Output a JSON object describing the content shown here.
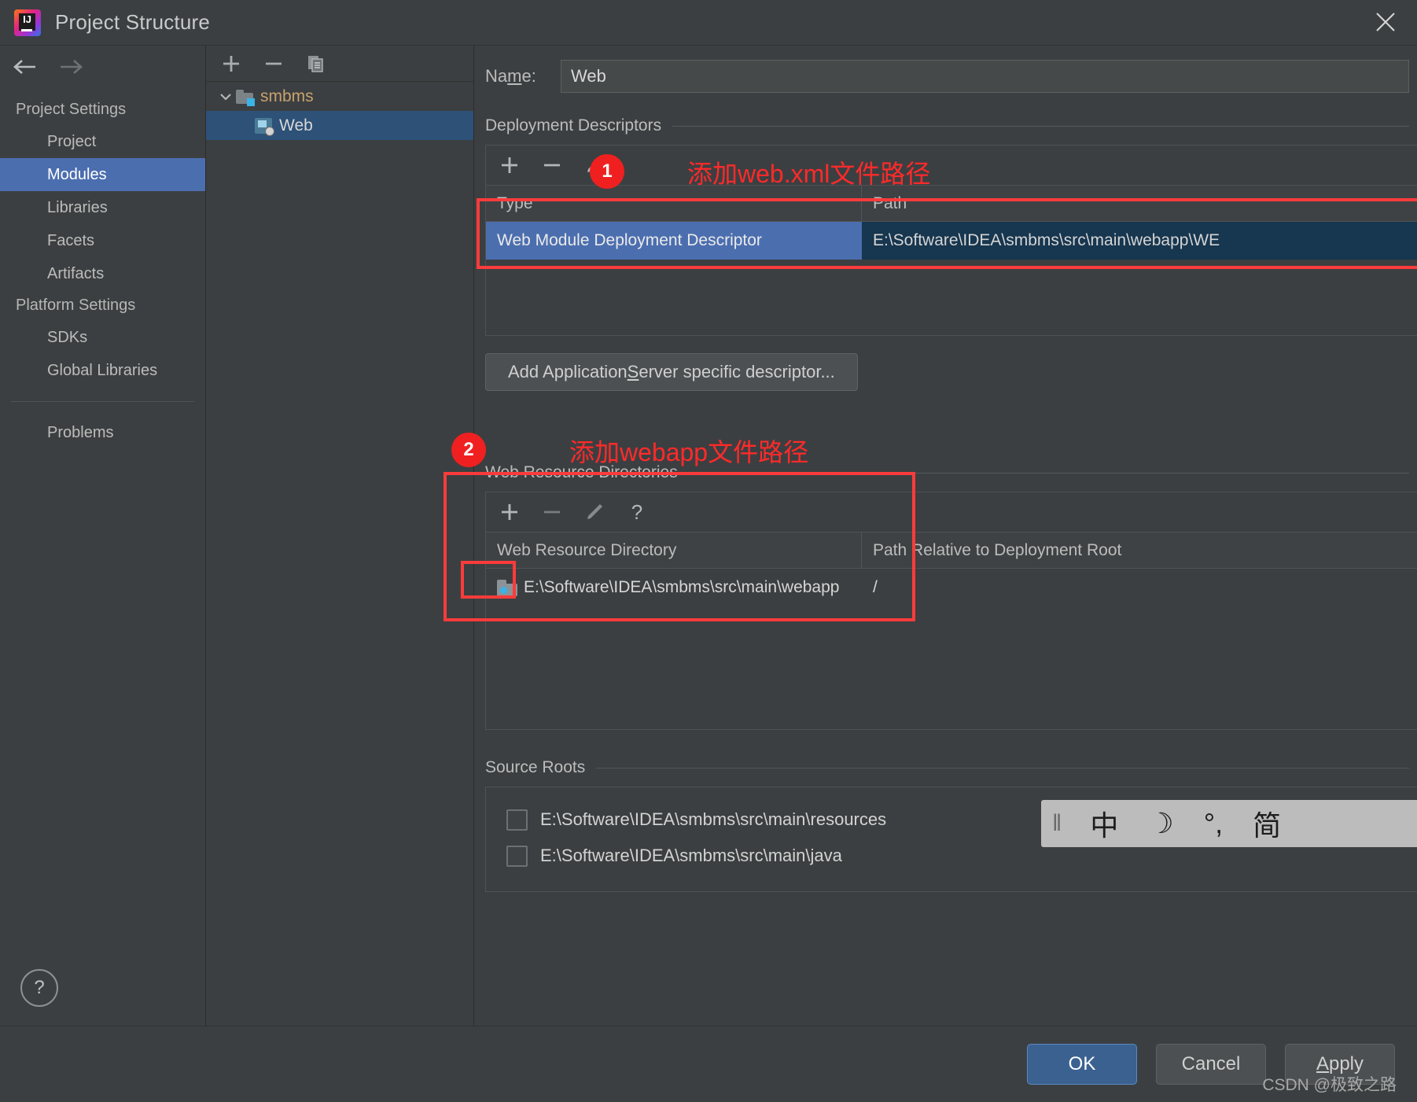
{
  "window": {
    "title": "Project Structure",
    "app_icon": "intellij-idea-logo",
    "close_label": "✕"
  },
  "sidebar": {
    "back_icon": "arrow-left-icon",
    "forward_icon": "arrow-right-icon",
    "groups": [
      {
        "label": "Project Settings",
        "items": [
          {
            "label": "Project",
            "selected": false
          },
          {
            "label": "Modules",
            "selected": true
          },
          {
            "label": "Libraries",
            "selected": false
          },
          {
            "label": "Facets",
            "selected": false
          },
          {
            "label": "Artifacts",
            "selected": false
          }
        ]
      },
      {
        "label": "Platform Settings",
        "items": [
          {
            "label": "SDKs",
            "selected": false
          },
          {
            "label": "Global Libraries",
            "selected": false
          }
        ]
      }
    ],
    "extra_items": [
      {
        "label": "Problems",
        "selected": false
      }
    ],
    "help_label": "?"
  },
  "tree": {
    "toolbar": [
      {
        "icon": "plus-icon",
        "label": "+"
      },
      {
        "icon": "minus-icon",
        "label": "−"
      },
      {
        "icon": "copy-icon",
        "label": "⧉"
      }
    ],
    "nodes": [
      {
        "label": "smbms",
        "icon": "module-folder-icon",
        "expanded": true,
        "selected": false
      },
      {
        "label": "Web",
        "icon": "web-facet-icon",
        "child": true,
        "selected": true
      }
    ]
  },
  "main": {
    "name_field": {
      "label_prefix": "Na",
      "label_mnemonic": "m",
      "label_suffix": ":",
      "value": "Web"
    },
    "deployment_descriptors": {
      "title": "Deployment Descriptors",
      "toolbar": [
        {
          "icon": "plus-icon",
          "label": "+"
        },
        {
          "icon": "minus-icon",
          "label": "−"
        },
        {
          "icon": "pencil-icon",
          "label": "✎"
        }
      ],
      "columns": [
        "Type",
        "Path"
      ],
      "rows": [
        {
          "type": "Web Module Deployment Descriptor",
          "path": "E:\\Software\\IDEA\\smbms\\src\\main\\webapp\\WE",
          "selected": true
        }
      ],
      "add_button": {
        "prefix": "Add Application ",
        "mnemonic": "S",
        "suffix": "erver specific descriptor..."
      }
    },
    "web_resource_directories": {
      "title": "Web Resource Directories",
      "toolbar": [
        {
          "icon": "plus-icon",
          "label": "+"
        },
        {
          "icon": "minus-icon",
          "label": "−"
        },
        {
          "icon": "pencil-icon",
          "label": "✎"
        },
        {
          "icon": "help-question-icon",
          "label": "?"
        }
      ],
      "columns": [
        "Web Resource Directory",
        "Path Relative to Deployment Root"
      ],
      "rows": [
        {
          "icon": "folder-web-icon",
          "directory": "E:\\Software\\IDEA\\smbms\\src\\main\\webapp",
          "relative_path": "/"
        }
      ]
    },
    "source_roots": {
      "title": "Source Roots",
      "rows": [
        {
          "label": "E:\\Software\\IDEA\\smbms\\src\\main\\resources",
          "checked": false
        },
        {
          "label": "E:\\Software\\IDEA\\smbms\\src\\main\\java",
          "checked": false
        }
      ]
    }
  },
  "annotations": {
    "callout_1": "1",
    "callout_1_text": "添加web.xml文件路径",
    "callout_2": "2",
    "callout_2_text": "添加webapp文件路径"
  },
  "footer": {
    "ok": "OK",
    "cancel": "Cancel",
    "apply_mnemonic": "A",
    "apply_rest": "pply",
    "watermark": "CSDN @极致之路"
  },
  "ime": {
    "grip": "‖",
    "mode": "中",
    "moon": "☽",
    "punct": "°,",
    "script": "简"
  },
  "colors": {
    "accent_selection": "#4b6eaf",
    "tree_selection": "#2d5177",
    "annotation_red": "#fb3b3b",
    "panel_bg": "#3c3f41"
  }
}
